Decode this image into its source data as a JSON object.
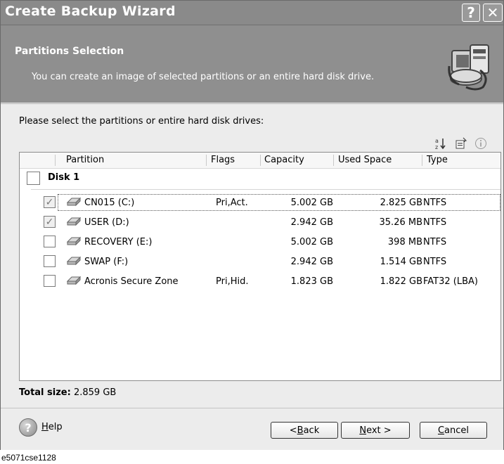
{
  "window": {
    "title": "Create Backup Wizard",
    "help_btn": "?",
    "close_btn": "✕"
  },
  "header": {
    "title": "Partitions Selection",
    "subtitle": "You can create an image of selected partitions or an entire hard disk drive."
  },
  "content": {
    "prompt": "Please select the partitions or entire hard disk drives:",
    "toolbar_icons": [
      "sort-icon",
      "properties-icon",
      "info-icon"
    ],
    "columns": [
      "Partition",
      "Flags",
      "Capacity",
      "Used Space",
      "Type"
    ],
    "disk": {
      "label": "Disk 1",
      "checked": false
    },
    "partitions": [
      {
        "name": "CN015 (C:)",
        "flags": "Pri,Act.",
        "capacity": "5.002 GB",
        "used": "2.825 GB",
        "type": "NTFS",
        "checked": true
      },
      {
        "name": "USER (D:)",
        "flags": "",
        "capacity": "2.942 GB",
        "used": "35.26 MB",
        "type": "NTFS",
        "checked": true
      },
      {
        "name": "RECOVERY (E:)",
        "flags": "",
        "capacity": "5.002 GB",
        "used": "398 MB",
        "type": "NTFS",
        "checked": false
      },
      {
        "name": "SWAP (F:)",
        "flags": "",
        "capacity": "2.942 GB",
        "used": "1.514 GB",
        "type": "NTFS",
        "checked": false
      },
      {
        "name": "Acronis Secure Zone",
        "flags": "Pri,Hid.",
        "capacity": "1.823 GB",
        "used": "1.822 GB",
        "type": "FAT32 (LBA)",
        "checked": false
      }
    ],
    "total_label": "Total size:",
    "total_value": "2.859 GB"
  },
  "footer": {
    "help": {
      "mnemonic": "H",
      "rest": "elp"
    },
    "back": {
      "pre": "< ",
      "mnemonic": "B",
      "rest": "ack"
    },
    "next": {
      "mnemonic": "N",
      "rest": "ext >"
    },
    "cancel": {
      "mnemonic": "C",
      "rest": "ancel"
    }
  },
  "caption": "e5071cse1128"
}
